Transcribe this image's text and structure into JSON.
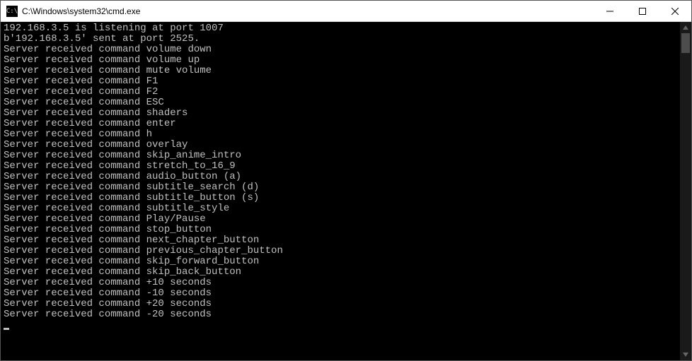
{
  "titlebar": {
    "icon_text": "C:\\",
    "title": "C:\\Windows\\system32\\cmd.exe"
  },
  "terminal": {
    "lines": [
      "192.168.3.5 is listening at port 1007",
      "b'192.168.3.5' sent at port 2525.",
      "Server received command volume down",
      "Server received command volume up",
      "Server received command mute volume",
      "Server received command F1",
      "Server received command F2",
      "Server received command ESC",
      "Server received command shaders",
      "Server received command enter",
      "Server received command h",
      "Server received command overlay",
      "Server received command skip_anime_intro",
      "Server received command stretch_to_16_9",
      "Server received command audio_button (a)",
      "Server received command subtitle_search (d)",
      "Server received command subtitle_button (s)",
      "Server received command subtitle_style",
      "Server received command Play/Pause",
      "Server received command stop_button",
      "Server received command next_chapter_button",
      "Server received command previous_chapter_button",
      "Server received command skip_forward_button",
      "Server received command skip_back_button",
      "Server received command +10 seconds",
      "Server received command -10 seconds",
      "Server received command +20 seconds",
      "Server received command -20 seconds"
    ]
  }
}
